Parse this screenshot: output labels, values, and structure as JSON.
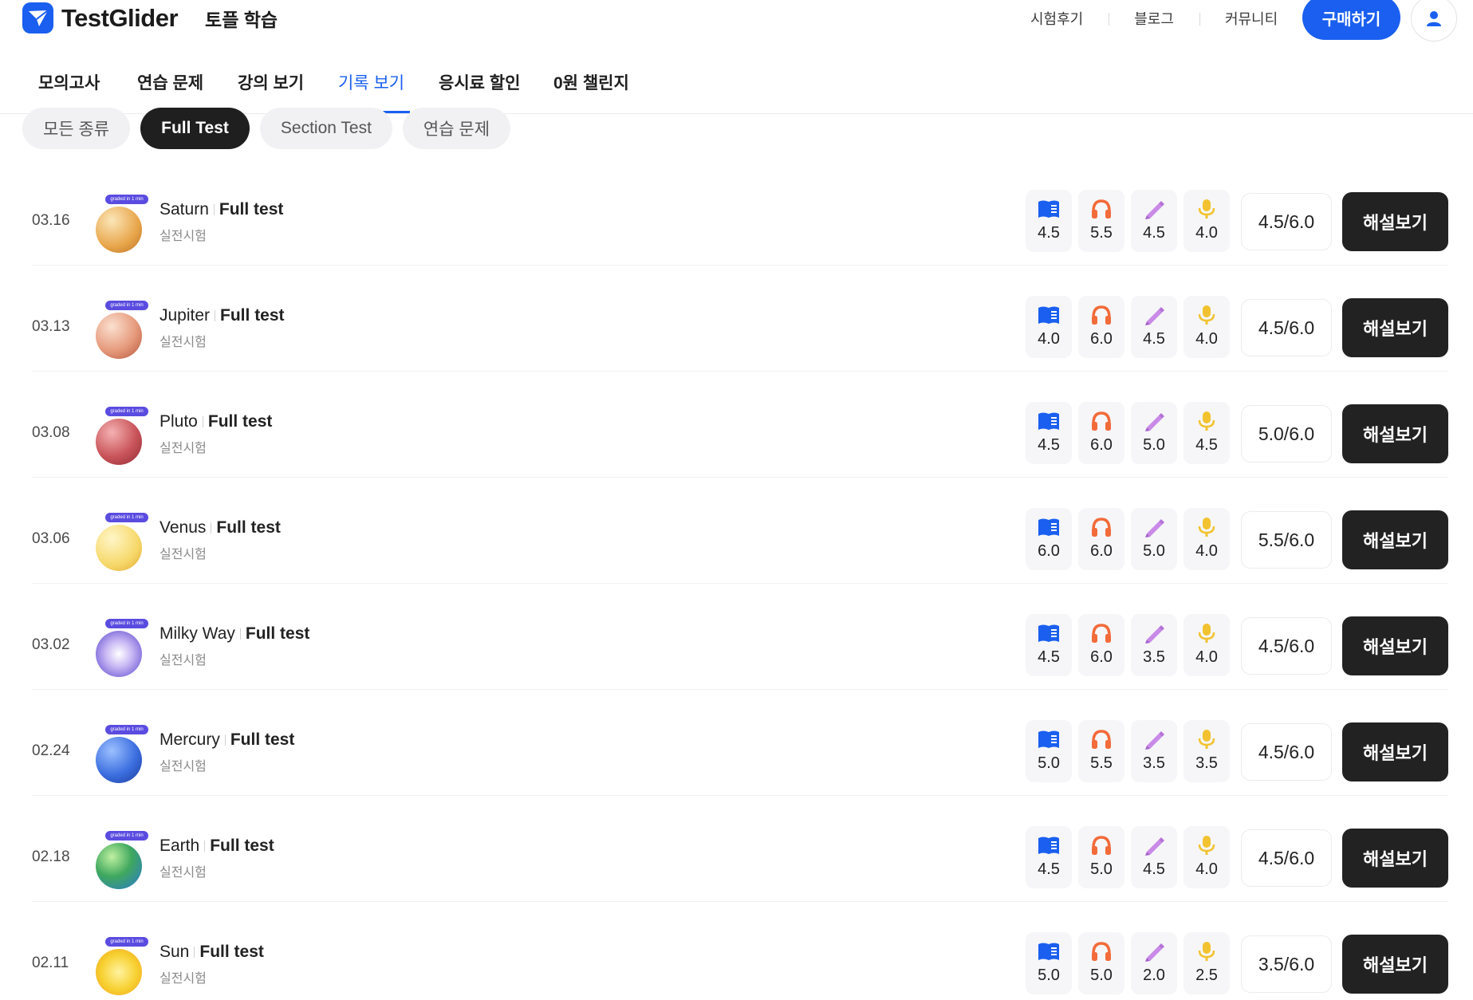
{
  "header": {
    "logo_text": "TestGlider",
    "logo_sub": "토플 학습",
    "links": [
      "시험후기",
      "블로그",
      "커뮤니티"
    ],
    "buy_label": "구매하기"
  },
  "nav": {
    "items": [
      "모의고사",
      "연습 문제",
      "강의 보기",
      "기록 보기",
      "응시료 할인",
      "0원 챌린지"
    ],
    "active": "기록 보기"
  },
  "filters": {
    "chips": [
      "모든 종류",
      "Full Test",
      "Section Test",
      "연습 문제"
    ],
    "active": "Full Test"
  },
  "badge_text": "graded in 1 min",
  "review_label": "해설보기",
  "colors": {
    "brand": "#1a5ff0",
    "reading": "#1a5ff0",
    "listening": "#f26b3a",
    "writing": "#c98ae8",
    "speaking": "#f2c230"
  },
  "records": [
    {
      "date": "03.16",
      "name": "Saturn",
      "type": "Full test",
      "subtitle": "실전시험",
      "reading": "4.5",
      "listening": "5.5",
      "writing": "4.5",
      "speaking": "4.0",
      "total": "4.5/6.0"
    },
    {
      "date": "03.13",
      "name": "Jupiter",
      "type": "Full test",
      "subtitle": "실전시험",
      "reading": "4.0",
      "listening": "6.0",
      "writing": "4.5",
      "speaking": "4.0",
      "total": "4.5/6.0"
    },
    {
      "date": "03.08",
      "name": "Pluto",
      "type": "Full test",
      "subtitle": "실전시험",
      "reading": "4.5",
      "listening": "6.0",
      "writing": "5.0",
      "speaking": "4.5",
      "total": "5.0/6.0"
    },
    {
      "date": "03.06",
      "name": "Venus",
      "type": "Full test",
      "subtitle": "실전시험",
      "reading": "6.0",
      "listening": "6.0",
      "writing": "5.0",
      "speaking": "4.0",
      "total": "5.5/6.0"
    },
    {
      "date": "03.02",
      "name": "Milky Way",
      "type": "Full test",
      "subtitle": "실전시험",
      "reading": "4.5",
      "listening": "6.0",
      "writing": "3.5",
      "speaking": "4.0",
      "total": "4.5/6.0"
    },
    {
      "date": "02.24",
      "name": "Mercury",
      "type": "Full test",
      "subtitle": "실전시험",
      "reading": "5.0",
      "listening": "5.5",
      "writing": "3.5",
      "speaking": "3.5",
      "total": "4.5/6.0"
    },
    {
      "date": "02.18",
      "name": "Earth",
      "type": "Full test",
      "subtitle": "실전시험",
      "reading": "4.5",
      "listening": "5.0",
      "writing": "4.5",
      "speaking": "4.0",
      "total": "4.5/6.0"
    },
    {
      "date": "02.11",
      "name": "Sun",
      "type": "Full test",
      "subtitle": "실전시험",
      "reading": "5.0",
      "listening": "5.0",
      "writing": "2.0",
      "speaking": "2.5",
      "total": "3.5/6.0"
    }
  ]
}
